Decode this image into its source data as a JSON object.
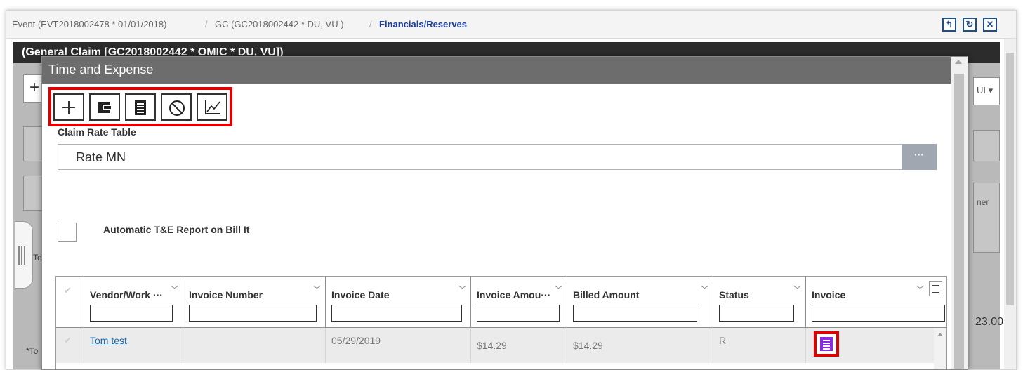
{
  "breadcrumb": {
    "event": "Event (EVT2018002478 * 01/01/2018)",
    "sep1": "/",
    "claim": "GC (GC2018002442 * DU, VU )",
    "sep2": "/",
    "current": "Financials/Reserves"
  },
  "header_buttons": [
    {
      "name": "back-icon",
      "glyph": "↰"
    },
    {
      "name": "refresh-icon",
      "glyph": "↻"
    },
    {
      "name": "close-icon",
      "glyph": "✕"
    }
  ],
  "background": {
    "claim_title": "(General Claim [GC2018002442 * OMIC * DU, VU])",
    "add_glyph": "+",
    "dropdown_text": "UI ▾",
    "owner_text": "ner",
    "total_text": "Tot",
    "amount_text": "23.00",
    "star_text": "*To"
  },
  "modal": {
    "title": "Time and Expense",
    "toolbar": [
      {
        "name": "add-icon",
        "label": "Add"
      },
      {
        "name": "wallet-icon",
        "label": "Wallet"
      },
      {
        "name": "document-icon",
        "label": "Document"
      },
      {
        "name": "void-icon",
        "label": "Void"
      },
      {
        "name": "chart-icon",
        "label": "Chart"
      }
    ],
    "rate_table_label": "Claim Rate Table",
    "rate_table_value": "Rate MN",
    "rate_table_button": "···",
    "auto_report_label": "Automatic T&E Report on Bill It",
    "auto_report_checked": false,
    "columns": [
      {
        "title": "Vendor/Work ···"
      },
      {
        "title": "Invoice Number"
      },
      {
        "title": "Invoice Date"
      },
      {
        "title": "Invoice Amou···"
      },
      {
        "title": "Billed Amount"
      },
      {
        "title": "Status"
      },
      {
        "title": "Invoice"
      }
    ],
    "rows": [
      {
        "vendor": "Tom test",
        "invoice_number": "",
        "invoice_date": "05/29/2019",
        "invoice_amount": "$14.29",
        "billed_amount": "$14.29",
        "status": "R",
        "invoice_icon": "invoice-document-icon"
      }
    ]
  },
  "colors": {
    "modal_title_bg": "#6d6d6d",
    "highlight": "#e00000",
    "invoice_icon": "#8b2be2",
    "link": "#1a6aa6",
    "breadcrumb_active": "#1a3c9c"
  }
}
